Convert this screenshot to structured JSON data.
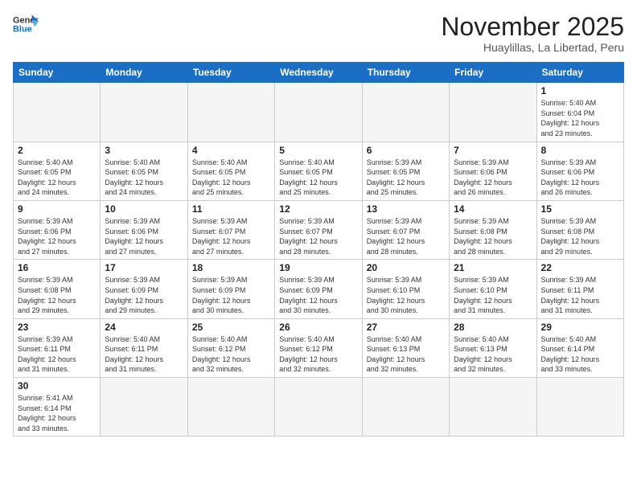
{
  "logo": {
    "line1": "General",
    "line2": "Blue"
  },
  "title": "November 2025",
  "location": "Huaylillas, La Libertad, Peru",
  "days_of_week": [
    "Sunday",
    "Monday",
    "Tuesday",
    "Wednesday",
    "Thursday",
    "Friday",
    "Saturday"
  ],
  "weeks": [
    [
      {
        "day": "",
        "info": ""
      },
      {
        "day": "",
        "info": ""
      },
      {
        "day": "",
        "info": ""
      },
      {
        "day": "",
        "info": ""
      },
      {
        "day": "",
        "info": ""
      },
      {
        "day": "",
        "info": ""
      },
      {
        "day": "1",
        "info": "Sunrise: 5:40 AM\nSunset: 6:04 PM\nDaylight: 12 hours\nand 23 minutes."
      }
    ],
    [
      {
        "day": "2",
        "info": "Sunrise: 5:40 AM\nSunset: 6:05 PM\nDaylight: 12 hours\nand 24 minutes."
      },
      {
        "day": "3",
        "info": "Sunrise: 5:40 AM\nSunset: 6:05 PM\nDaylight: 12 hours\nand 24 minutes."
      },
      {
        "day": "4",
        "info": "Sunrise: 5:40 AM\nSunset: 6:05 PM\nDaylight: 12 hours\nand 25 minutes."
      },
      {
        "day": "5",
        "info": "Sunrise: 5:40 AM\nSunset: 6:05 PM\nDaylight: 12 hours\nand 25 minutes."
      },
      {
        "day": "6",
        "info": "Sunrise: 5:39 AM\nSunset: 6:05 PM\nDaylight: 12 hours\nand 25 minutes."
      },
      {
        "day": "7",
        "info": "Sunrise: 5:39 AM\nSunset: 6:06 PM\nDaylight: 12 hours\nand 26 minutes."
      },
      {
        "day": "8",
        "info": "Sunrise: 5:39 AM\nSunset: 6:06 PM\nDaylight: 12 hours\nand 26 minutes."
      }
    ],
    [
      {
        "day": "9",
        "info": "Sunrise: 5:39 AM\nSunset: 6:06 PM\nDaylight: 12 hours\nand 27 minutes."
      },
      {
        "day": "10",
        "info": "Sunrise: 5:39 AM\nSunset: 6:06 PM\nDaylight: 12 hours\nand 27 minutes."
      },
      {
        "day": "11",
        "info": "Sunrise: 5:39 AM\nSunset: 6:07 PM\nDaylight: 12 hours\nand 27 minutes."
      },
      {
        "day": "12",
        "info": "Sunrise: 5:39 AM\nSunset: 6:07 PM\nDaylight: 12 hours\nand 28 minutes."
      },
      {
        "day": "13",
        "info": "Sunrise: 5:39 AM\nSunset: 6:07 PM\nDaylight: 12 hours\nand 28 minutes."
      },
      {
        "day": "14",
        "info": "Sunrise: 5:39 AM\nSunset: 6:08 PM\nDaylight: 12 hours\nand 28 minutes."
      },
      {
        "day": "15",
        "info": "Sunrise: 5:39 AM\nSunset: 6:08 PM\nDaylight: 12 hours\nand 29 minutes."
      }
    ],
    [
      {
        "day": "16",
        "info": "Sunrise: 5:39 AM\nSunset: 6:08 PM\nDaylight: 12 hours\nand 29 minutes."
      },
      {
        "day": "17",
        "info": "Sunrise: 5:39 AM\nSunset: 6:09 PM\nDaylight: 12 hours\nand 29 minutes."
      },
      {
        "day": "18",
        "info": "Sunrise: 5:39 AM\nSunset: 6:09 PM\nDaylight: 12 hours\nand 30 minutes."
      },
      {
        "day": "19",
        "info": "Sunrise: 5:39 AM\nSunset: 6:09 PM\nDaylight: 12 hours\nand 30 minutes."
      },
      {
        "day": "20",
        "info": "Sunrise: 5:39 AM\nSunset: 6:10 PM\nDaylight: 12 hours\nand 30 minutes."
      },
      {
        "day": "21",
        "info": "Sunrise: 5:39 AM\nSunset: 6:10 PM\nDaylight: 12 hours\nand 31 minutes."
      },
      {
        "day": "22",
        "info": "Sunrise: 5:39 AM\nSunset: 6:11 PM\nDaylight: 12 hours\nand 31 minutes."
      }
    ],
    [
      {
        "day": "23",
        "info": "Sunrise: 5:39 AM\nSunset: 6:11 PM\nDaylight: 12 hours\nand 31 minutes."
      },
      {
        "day": "24",
        "info": "Sunrise: 5:40 AM\nSunset: 6:11 PM\nDaylight: 12 hours\nand 31 minutes."
      },
      {
        "day": "25",
        "info": "Sunrise: 5:40 AM\nSunset: 6:12 PM\nDaylight: 12 hours\nand 32 minutes."
      },
      {
        "day": "26",
        "info": "Sunrise: 5:40 AM\nSunset: 6:12 PM\nDaylight: 12 hours\nand 32 minutes."
      },
      {
        "day": "27",
        "info": "Sunrise: 5:40 AM\nSunset: 6:13 PM\nDaylight: 12 hours\nand 32 minutes."
      },
      {
        "day": "28",
        "info": "Sunrise: 5:40 AM\nSunset: 6:13 PM\nDaylight: 12 hours\nand 32 minutes."
      },
      {
        "day": "29",
        "info": "Sunrise: 5:40 AM\nSunset: 6:14 PM\nDaylight: 12 hours\nand 33 minutes."
      }
    ],
    [
      {
        "day": "30",
        "info": "Sunrise: 5:41 AM\nSunset: 6:14 PM\nDaylight: 12 hours\nand 33 minutes."
      },
      {
        "day": "",
        "info": ""
      },
      {
        "day": "",
        "info": ""
      },
      {
        "day": "",
        "info": ""
      },
      {
        "day": "",
        "info": ""
      },
      {
        "day": "",
        "info": ""
      },
      {
        "day": "",
        "info": ""
      }
    ]
  ]
}
